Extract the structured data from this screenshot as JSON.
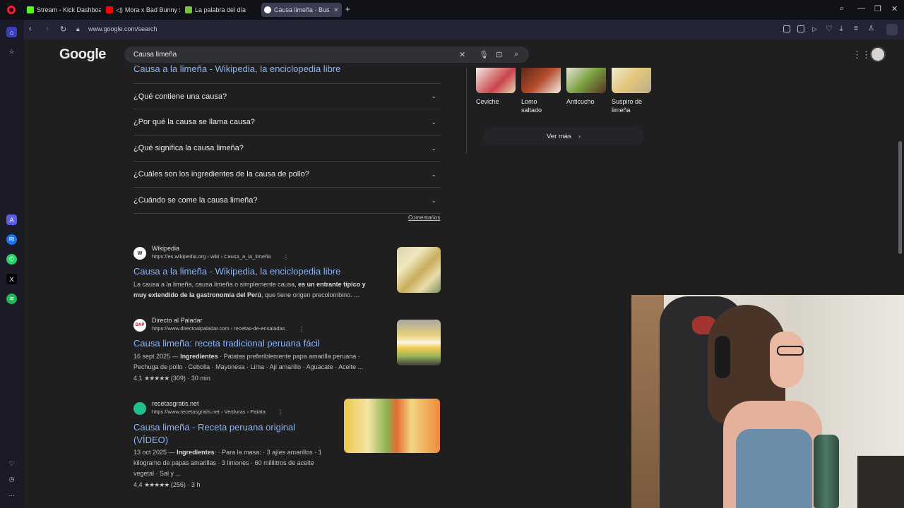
{
  "tabs": [
    {
      "label": "Stream - Kick Dashboard",
      "color": "#53fc18"
    },
    {
      "label": "Mora x Bad Bunny x S",
      "color": "#ff0000"
    },
    {
      "label": "La palabra del día",
      "color": "#7bc043"
    },
    {
      "label": "Causa limeña - Buscar",
      "color": "#ffffff"
    }
  ],
  "address": {
    "url": "www.google.com/search"
  },
  "google": {
    "logo": "Google",
    "query": "Causa limeña"
  },
  "top_link": "Causa a la limeña - Wikipedia, la enciclopedia libre",
  "faqs": [
    "¿Qué contiene una causa?",
    "¿Por qué la causa se llama causa?",
    "¿Qué significa la causa limeña?",
    "¿Cuáles son los ingredientes de la causa de pollo?",
    "¿Cuándo se come la causa limeña?"
  ],
  "feedback": "Comentarios",
  "results": [
    {
      "site": "Wikipedia",
      "icon": "W",
      "url": "https://es.wikipedia.org › wiki › Causa_a_la_limeña",
      "title": "Causa a la limeña - Wikipedia, la enciclopedia libre",
      "snippet_1a": "La causa a la limeña, causa limeña o simplemente causa, ",
      "snippet_1b": "es un entrante típico y",
      "snippet_2a": "muy extendido de la gastronomía del Perú",
      "snippet_2b": ", que tiene origen precolombino. ..."
    },
    {
      "site": "Directo al Paladar",
      "icon": "DAP",
      "url": "https://www.directoalpaladar.com › recetas-de-ensaladas",
      "title": "Causa limeña: receta tradicional peruana fácil",
      "date": "16 sept 2025 —",
      "bold": "Ingredientes",
      "snippet_1": "· Patatas preferiblemente papa amarilla peruana ·",
      "snippet_2": "Pechuga de pollo · Cebolla · Mayonesa · Lima · Ají amarillo · Aguacate · Aceite ...",
      "rating": "4,1",
      "stars": "★★★★★",
      "reviews": "(309) · 30 min"
    },
    {
      "site": "recetasgratis.net",
      "icon": "R",
      "url": "https://www.recetasgratis.net › Verduras › Patata",
      "title_1": "Causa limeña - Receta peruana original",
      "title_2": "(VÍDEO)",
      "date": "13 oct 2025 —",
      "bold": "Ingredientes",
      "snippet_1": ": · Para la masa: · 3 ajíes amarillos · 1",
      "snippet_2": "kilogramo de papas amarillas · 3 limones · 60 mililitros de aceite",
      "snippet_3": "vegetal · Sal y ...",
      "rating": "4,4",
      "stars": "★★★★★",
      "reviews": "(256) · 3 h"
    }
  ],
  "related_dishes": [
    "Ceviche",
    "Lomo saltado",
    "Anticucho",
    "Suspiro de limeña"
  ],
  "ver_mas": "Ver más"
}
